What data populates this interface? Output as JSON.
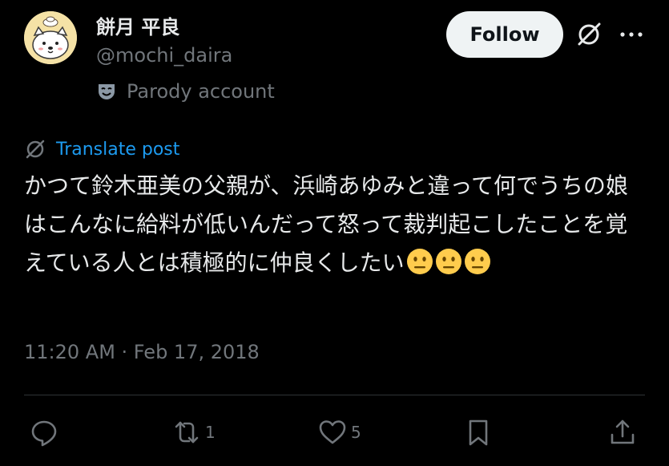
{
  "user": {
    "display_name": "餅月 平良",
    "handle": "@mochi_daira",
    "parody_label": "Parody account",
    "avatar_icon": "dog-avatar"
  },
  "header": {
    "follow_label": "Follow",
    "grok_icon": "grok-icon",
    "more_icon": "more-dots-icon"
  },
  "post": {
    "translate_label": "Translate post",
    "text": "かつて鈴木亜美の父親が、浜崎あゆみと違って何でうちの娘はこんなに給料が低いんだって怒って裁判起こしたことを覚えている人とは積極的に仲良くしたい",
    "emoji_count": 3,
    "emoji_name": "neutral-face-emoji",
    "timestamp": "11:20 AM · Feb 17, 2018"
  },
  "actions": {
    "reply_count": "",
    "repost_count": "1",
    "like_count": "5"
  },
  "colors": {
    "background": "#000000",
    "text": "#e7e9ea",
    "muted": "#71767b",
    "accent": "#1d9bf0",
    "follow_bg": "#eff3f4"
  }
}
